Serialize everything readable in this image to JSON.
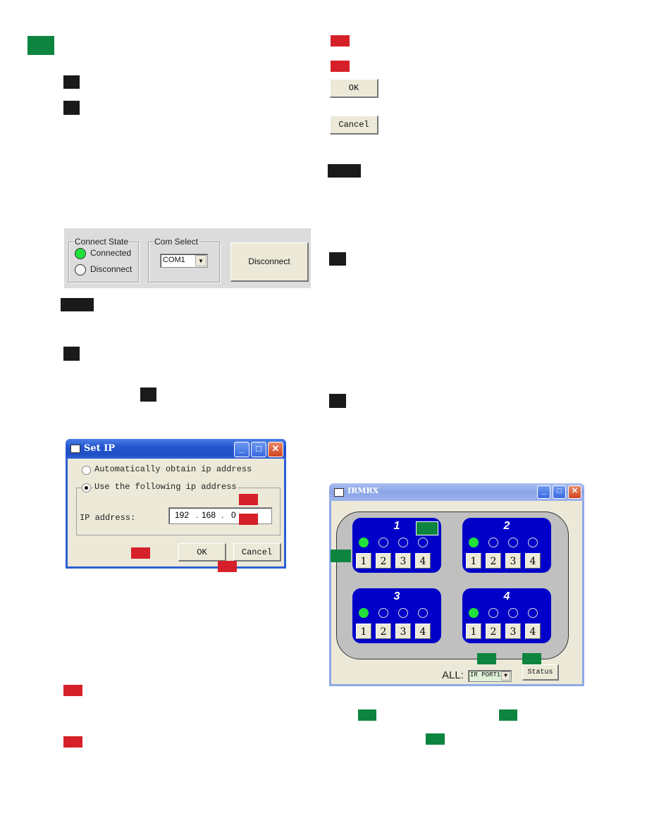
{
  "connect_panel": {
    "connect_state_title": "Connect State",
    "connected_label": "Connected",
    "disconnect_radio_label": "Disconnect",
    "connected_led": "on",
    "com_select_title": "Com Select",
    "com_value": "COM1",
    "disconnect_button": "Disconnect",
    "dropdown_arrow": "▼"
  },
  "set_ip_dialog": {
    "title": "Set IP",
    "auto_option": "Automatically obtain ip address",
    "manual_option": "Use the following ip address",
    "selected_option": "manual",
    "ip_label": "IP address:",
    "ip_octets": [
      "192",
      "168",
      "0",
      ""
    ],
    "ip_separator": ".",
    "ok_button": "OK",
    "cancel_button": "Cancel",
    "minimize": "_",
    "maximize": "□",
    "close": "✕"
  },
  "standalone_buttons": {
    "ok": "OK",
    "cancel": "Cancel"
  },
  "ir_window": {
    "title": "IRMRX",
    "minimize": "_",
    "maximize": "□",
    "close": "✕",
    "zones": [
      {
        "number": "1",
        "active_port": 1,
        "buttons": [
          "1",
          "2",
          "3",
          "4"
        ]
      },
      {
        "number": "2",
        "active_port": 1,
        "buttons": [
          "1",
          "2",
          "3",
          "4"
        ]
      },
      {
        "number": "3",
        "active_port": 1,
        "buttons": [
          "1",
          "2",
          "3",
          "4"
        ]
      },
      {
        "number": "4",
        "active_port": 1,
        "buttons": [
          "1",
          "2",
          "3",
          "4"
        ]
      }
    ],
    "all_label": "ALL:",
    "all_select_value": "IR PORT1",
    "dropdown_arrow": "▼",
    "status_button": "Status"
  },
  "colors": {
    "green_marker": "#0d8540",
    "red_marker": "#d62029",
    "black_marker": "#1b1a1b",
    "zone_blue": "#0000c8",
    "led_on": "#22e03a"
  }
}
